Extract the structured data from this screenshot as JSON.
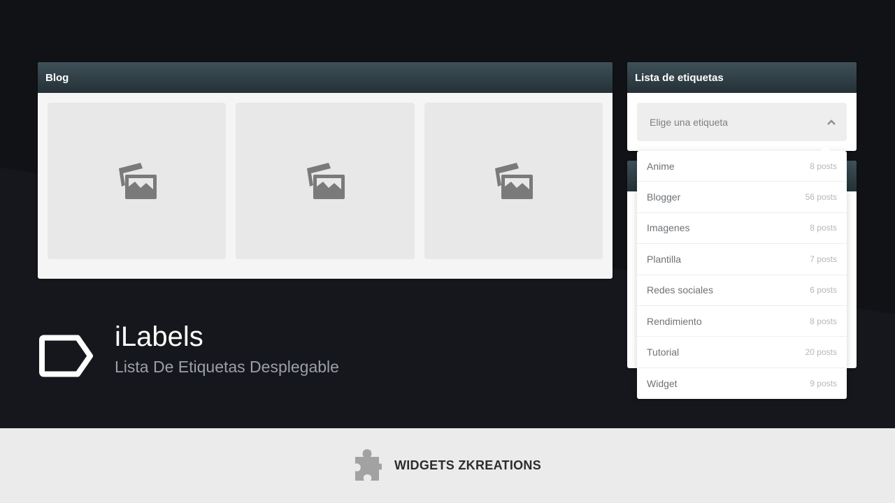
{
  "blog_panel": {
    "title": "Blog",
    "thumbnails": [
      "image-placeholder",
      "image-placeholder",
      "image-placeholder"
    ]
  },
  "labels_panel": {
    "title": "Lista de etiquetas",
    "select_placeholder": "Elige una etiqueta",
    "options": [
      {
        "name": "Anime",
        "count": "8 posts"
      },
      {
        "name": "Blogger",
        "count": "56 posts"
      },
      {
        "name": "Imagenes",
        "count": "8 posts"
      },
      {
        "name": "Plantilla",
        "count": "7 posts"
      },
      {
        "name": "Redes sociales",
        "count": "6 posts"
      },
      {
        "name": "Rendimiento",
        "count": "8 posts"
      },
      {
        "name": "Tutorial",
        "count": "20 posts"
      },
      {
        "name": "Widget",
        "count": "9 posts"
      }
    ]
  },
  "hero": {
    "title": "iLabels",
    "subtitle": "Lista De Etiquetas Desplegable",
    "icon": "tag-icon"
  },
  "footer": {
    "brand": "WIDGETS ZKREATIONS",
    "icon": "puzzle-icon"
  },
  "colors": {
    "background": "#111216",
    "header": "#2c3a40",
    "footer": "#ebebeb"
  }
}
